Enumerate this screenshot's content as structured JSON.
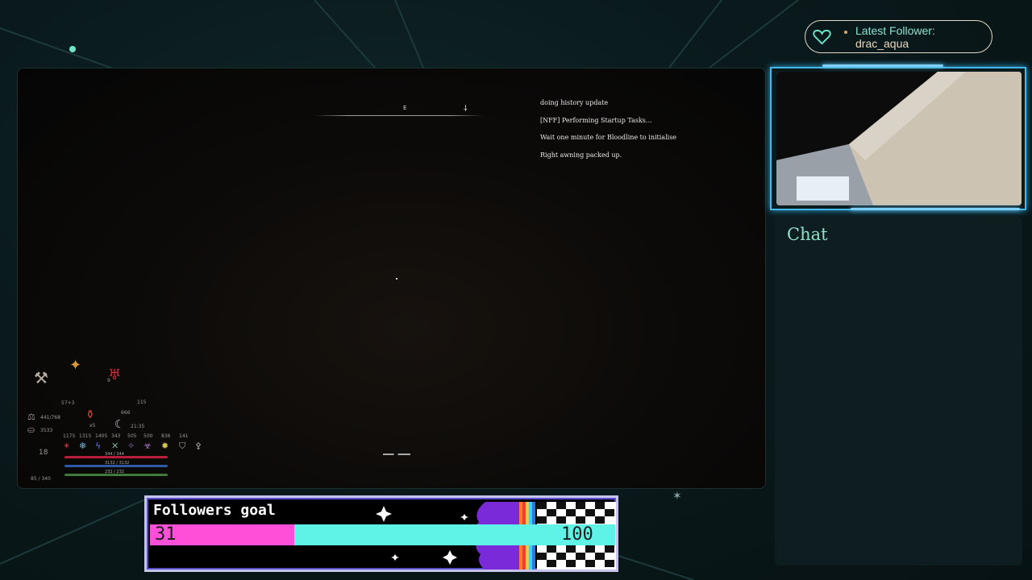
{
  "game": {
    "compass_heading": "E",
    "messages": [
      "doing history update",
      "[NFF] Performing Startup Tasks...",
      "Wait one minute for Bloodline to initialise",
      "Right awning packed up."
    ],
    "hud": {
      "weapon_damage": "57+3",
      "weight": "441/768",
      "gold": "3533",
      "level": "18",
      "potion_count": "x5",
      "food": "9",
      "fatigue": "115",
      "time_value": "666",
      "clock": "21:35",
      "resistances": [
        "1175",
        "1315",
        "1405",
        "343",
        "505",
        "500",
        "836",
        "141"
      ],
      "health_label": "344 / 344",
      "magicka_label": "3132 / 3132",
      "stamina_label": "232 / 232",
      "experience_label": "85 / 340"
    }
  },
  "latest_follower": {
    "label": "Latest Follower:",
    "name": "drac_aqua"
  },
  "chat": {
    "title": "Chat"
  },
  "followers_goal": {
    "title": "Followers goal",
    "current": "31",
    "target": "100",
    "progress": 0.31,
    "colors": {
      "fill": "#ff4fd8",
      "remaining": "#5ff3e7",
      "finish": "#7a2ad8"
    }
  }
}
